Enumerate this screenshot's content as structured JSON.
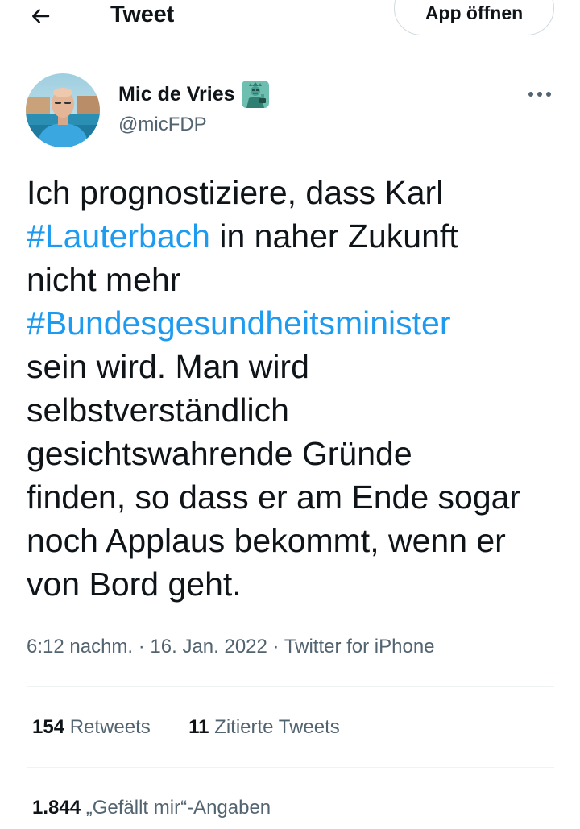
{
  "header": {
    "title": "Tweet",
    "open_app_label": "App öffnen"
  },
  "author": {
    "name": "Mic de Vries",
    "name_emoji": "statue-of-liberty",
    "handle": "@micFDP"
  },
  "tweet": {
    "lines": [
      [
        {
          "text": "Ich prognostiziere, dass Karl",
          "hashtag": false
        }
      ],
      [
        {
          "text": "#Lauterbach",
          "hashtag": true
        },
        {
          "text": " in naher Zukunft",
          "hashtag": false
        }
      ],
      [
        {
          "text": "nicht mehr",
          "hashtag": false
        }
      ],
      [
        {
          "text": "#Bundesgesundheitsminister",
          "hashtag": true
        }
      ],
      [
        {
          "text": "sein wird. Man wird",
          "hashtag": false
        }
      ],
      [
        {
          "text": "selbstverständlich",
          "hashtag": false
        }
      ],
      [
        {
          "text": "gesichtswahrende Gründe",
          "hashtag": false
        }
      ],
      [
        {
          "text": "finden, so dass er am Ende sogar",
          "hashtag": false
        }
      ],
      [
        {
          "text": "noch Applaus bekommt, wenn er",
          "hashtag": false
        }
      ],
      [
        {
          "text": "von Bord geht.",
          "hashtag": false
        }
      ]
    ],
    "time": "6:12 nachm.",
    "separator": " · ",
    "date": "16. Jan. 2022",
    "source": "Twitter for iPhone"
  },
  "stats": {
    "retweets_count": "154",
    "retweets_label": "Retweets",
    "quotes_count": "11",
    "quotes_label": "Zitierte Tweets",
    "likes_count": "1.844",
    "likes_label": "„Gefällt mir“-Angaben"
  },
  "colors": {
    "text": "#0f1419",
    "secondary": "#536471",
    "link": "#1d9bf0",
    "border": "#cfd9de",
    "divider": "#eff3f4"
  }
}
